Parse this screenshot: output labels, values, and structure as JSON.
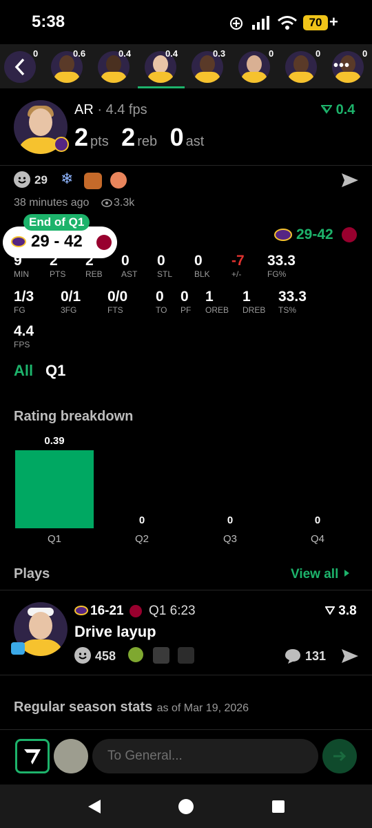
{
  "status_bar": {
    "time": "5:38",
    "battery": "70",
    "battery_extra": "+"
  },
  "players_strip": {
    "values": [
      "0",
      "0.6",
      "0.4",
      "0.4",
      "0.3",
      "0",
      "0",
      "0"
    ],
    "more_label": "•••"
  },
  "player": {
    "name": "AR",
    "fps_text": "· 4.4 fps",
    "rating_change": "0.4",
    "pts": "2",
    "pts_label": "pts",
    "reb": "2",
    "reb_label": "reb",
    "ast": "0",
    "ast_label": "ast"
  },
  "social": {
    "reaction_count": "29",
    "time_ago": "38 minutes ago",
    "views": "3.3k"
  },
  "score_badge": {
    "period": "End of Q1",
    "score": "29 - 42"
  },
  "game_score": {
    "away": "29",
    "sep": "-",
    "home": "42"
  },
  "stats_row1": [
    {
      "value": "9",
      "label": "MIN"
    },
    {
      "value": "2",
      "label": "PTS"
    },
    {
      "value": "2",
      "label": "REB"
    },
    {
      "value": "0",
      "label": "AST"
    },
    {
      "value": "0",
      "label": "STL"
    },
    {
      "value": "0",
      "label": "BLK"
    },
    {
      "value": "-7",
      "label": "+/-"
    },
    {
      "value": "33.3",
      "label": "FG%"
    }
  ],
  "stats_row2": [
    {
      "value": "1/3",
      "label": "FG"
    },
    {
      "value": "0/1",
      "label": "3FG"
    },
    {
      "value": "0/0",
      "label": "FTS"
    },
    {
      "value": "0",
      "label": "TO"
    },
    {
      "value": "0",
      "label": "PF"
    },
    {
      "value": "1",
      "label": "OREB"
    },
    {
      "value": "1",
      "label": "DREB"
    },
    {
      "value": "33.3",
      "label": "TS%"
    }
  ],
  "stats_row3": [
    {
      "value": "4.4",
      "label": "FPS"
    }
  ],
  "period_tabs": [
    "All",
    "Q1"
  ],
  "rating_breakdown": {
    "title": "Rating breakdown",
    "chart_data": {
      "type": "bar",
      "categories": [
        "Q1",
        "Q2",
        "Q3",
        "Q4"
      ],
      "values": [
        0.39,
        0,
        0,
        0
      ],
      "value_labels": [
        "0.39",
        "0",
        "0",
        "0"
      ],
      "bar_color": "#00a862"
    }
  },
  "plays": {
    "title": "Plays",
    "view_all": "View all",
    "item": {
      "away_score": "16",
      "sep": "-",
      "home_score": "21",
      "clock": "Q1 6:23",
      "rating": "3.8",
      "title": "Drive layup",
      "reactions": "458",
      "comments": "131"
    }
  },
  "regular_season": {
    "title": "Regular season stats",
    "as_of": "as of Mar 19, 2026"
  },
  "chat": {
    "placeholder": "To General..."
  },
  "colors": {
    "accent": "#1db36b",
    "negative": "#e0322f",
    "lakers_gold": "#f6c22e",
    "lakers_purple": "#552583",
    "heat_red": "#98002e"
  }
}
